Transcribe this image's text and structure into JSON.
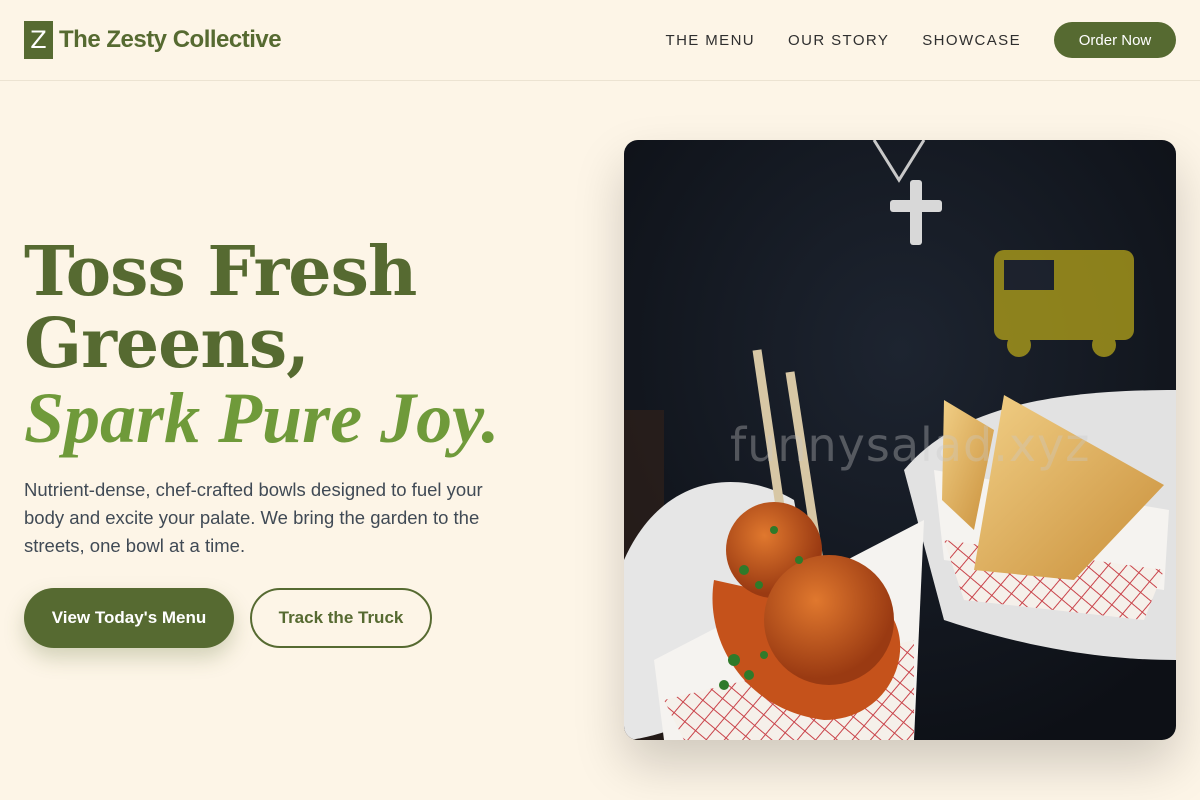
{
  "brand": {
    "logo_letter": "Z",
    "name": "The Zesty Collective"
  },
  "nav": {
    "items": [
      {
        "label": "THE MENU"
      },
      {
        "label": "OUR STORY"
      },
      {
        "label": "SHOWCASE"
      }
    ],
    "cta_label": "Order Now"
  },
  "hero": {
    "headline_line1": "Toss Fresh",
    "headline_line2": "Greens,",
    "headline_accent": "Spark Pure Joy.",
    "subcopy": "Nutrient-dense, chef-crafted bowls designed to fuel your body and excite your palate. We bring the garden to the streets, one bowl at a time.",
    "primary_cta": "View Today's Menu",
    "secondary_cta": "Track the Truck",
    "image_watermark": "funnysalad.xyz"
  },
  "colors": {
    "brand_green": "#566a31",
    "accent_green": "#6f9a3a",
    "background": "#fdf5e7"
  }
}
